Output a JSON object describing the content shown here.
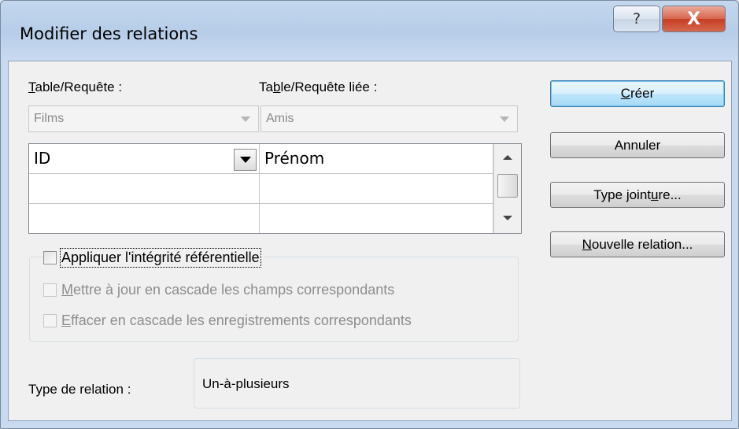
{
  "window": {
    "title": "Modifier des relations",
    "help_glyph": "?",
    "close_glyph": "X"
  },
  "table": {
    "label_first": "T",
    "label_rest": "able/Requête :",
    "value": "Films"
  },
  "related": {
    "label_pre": "Ta",
    "label_key": "b",
    "label_rest": "le/Requête liée :",
    "value": "Amis"
  },
  "fields": {
    "rows": [
      {
        "left": "ID",
        "right": "Prénom"
      },
      {
        "left": "",
        "right": ""
      },
      {
        "left": "",
        "right": ""
      }
    ]
  },
  "options": {
    "integrity": {
      "label": "Appliquer l'intégrité référentielle",
      "checked": false
    },
    "cascade_update": {
      "key": "M",
      "rest": "ettre à jour en cascade les champs correspondants",
      "checked": false
    },
    "cascade_delete": {
      "key": "E",
      "rest": "ffacer en cascade les enregistrements correspondants",
      "checked": false
    }
  },
  "relation_type": {
    "label": "Type de relation :",
    "value": "Un-à-plusieurs"
  },
  "buttons": {
    "create": {
      "key": "C",
      "rest": "réer"
    },
    "cancel": {
      "label": "Annuler"
    },
    "join": {
      "pre": "Type joint",
      "key": "u",
      "rest": "re..."
    },
    "new": {
      "key": "N",
      "rest": "ouvelle relation..."
    }
  }
}
